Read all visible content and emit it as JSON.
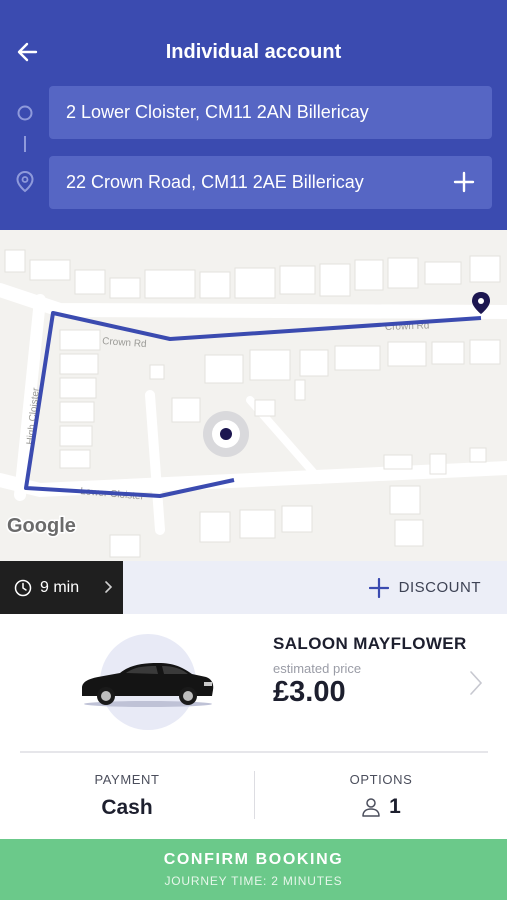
{
  "header": {
    "title": "Individual account",
    "from_address": "2 Lower Cloister, CM11 2AN Billericay",
    "to_address": "22 Crown Road, CM11 2AE Billericay",
    "background_color": "#3b4bb0",
    "icons": [
      "back-arrow-icon",
      "origin-circle-icon",
      "destination-pin-icon",
      "plus-icon"
    ]
  },
  "map": {
    "street_labels": [
      "Crown Rd",
      "Crown Rd",
      "High Cloister",
      "Lower Cloister"
    ],
    "attribution": "Google",
    "route_color": "#3b4bb0"
  },
  "trip_bar": {
    "duration": "9 min",
    "discount_label": "DISCOUNT"
  },
  "vehicle": {
    "name": "SALOON MAYFLOWER",
    "estimated_label": "estimated price",
    "price": "£3.00"
  },
  "payment": {
    "label": "PAYMENT",
    "value": "Cash"
  },
  "options": {
    "label": "OPTIONS",
    "passengers": "1"
  },
  "confirm": {
    "label": "CONFIRM BOOKING",
    "sublabel": "JOURNEY TIME: 2 MINUTES",
    "color": "#6bc98a"
  }
}
